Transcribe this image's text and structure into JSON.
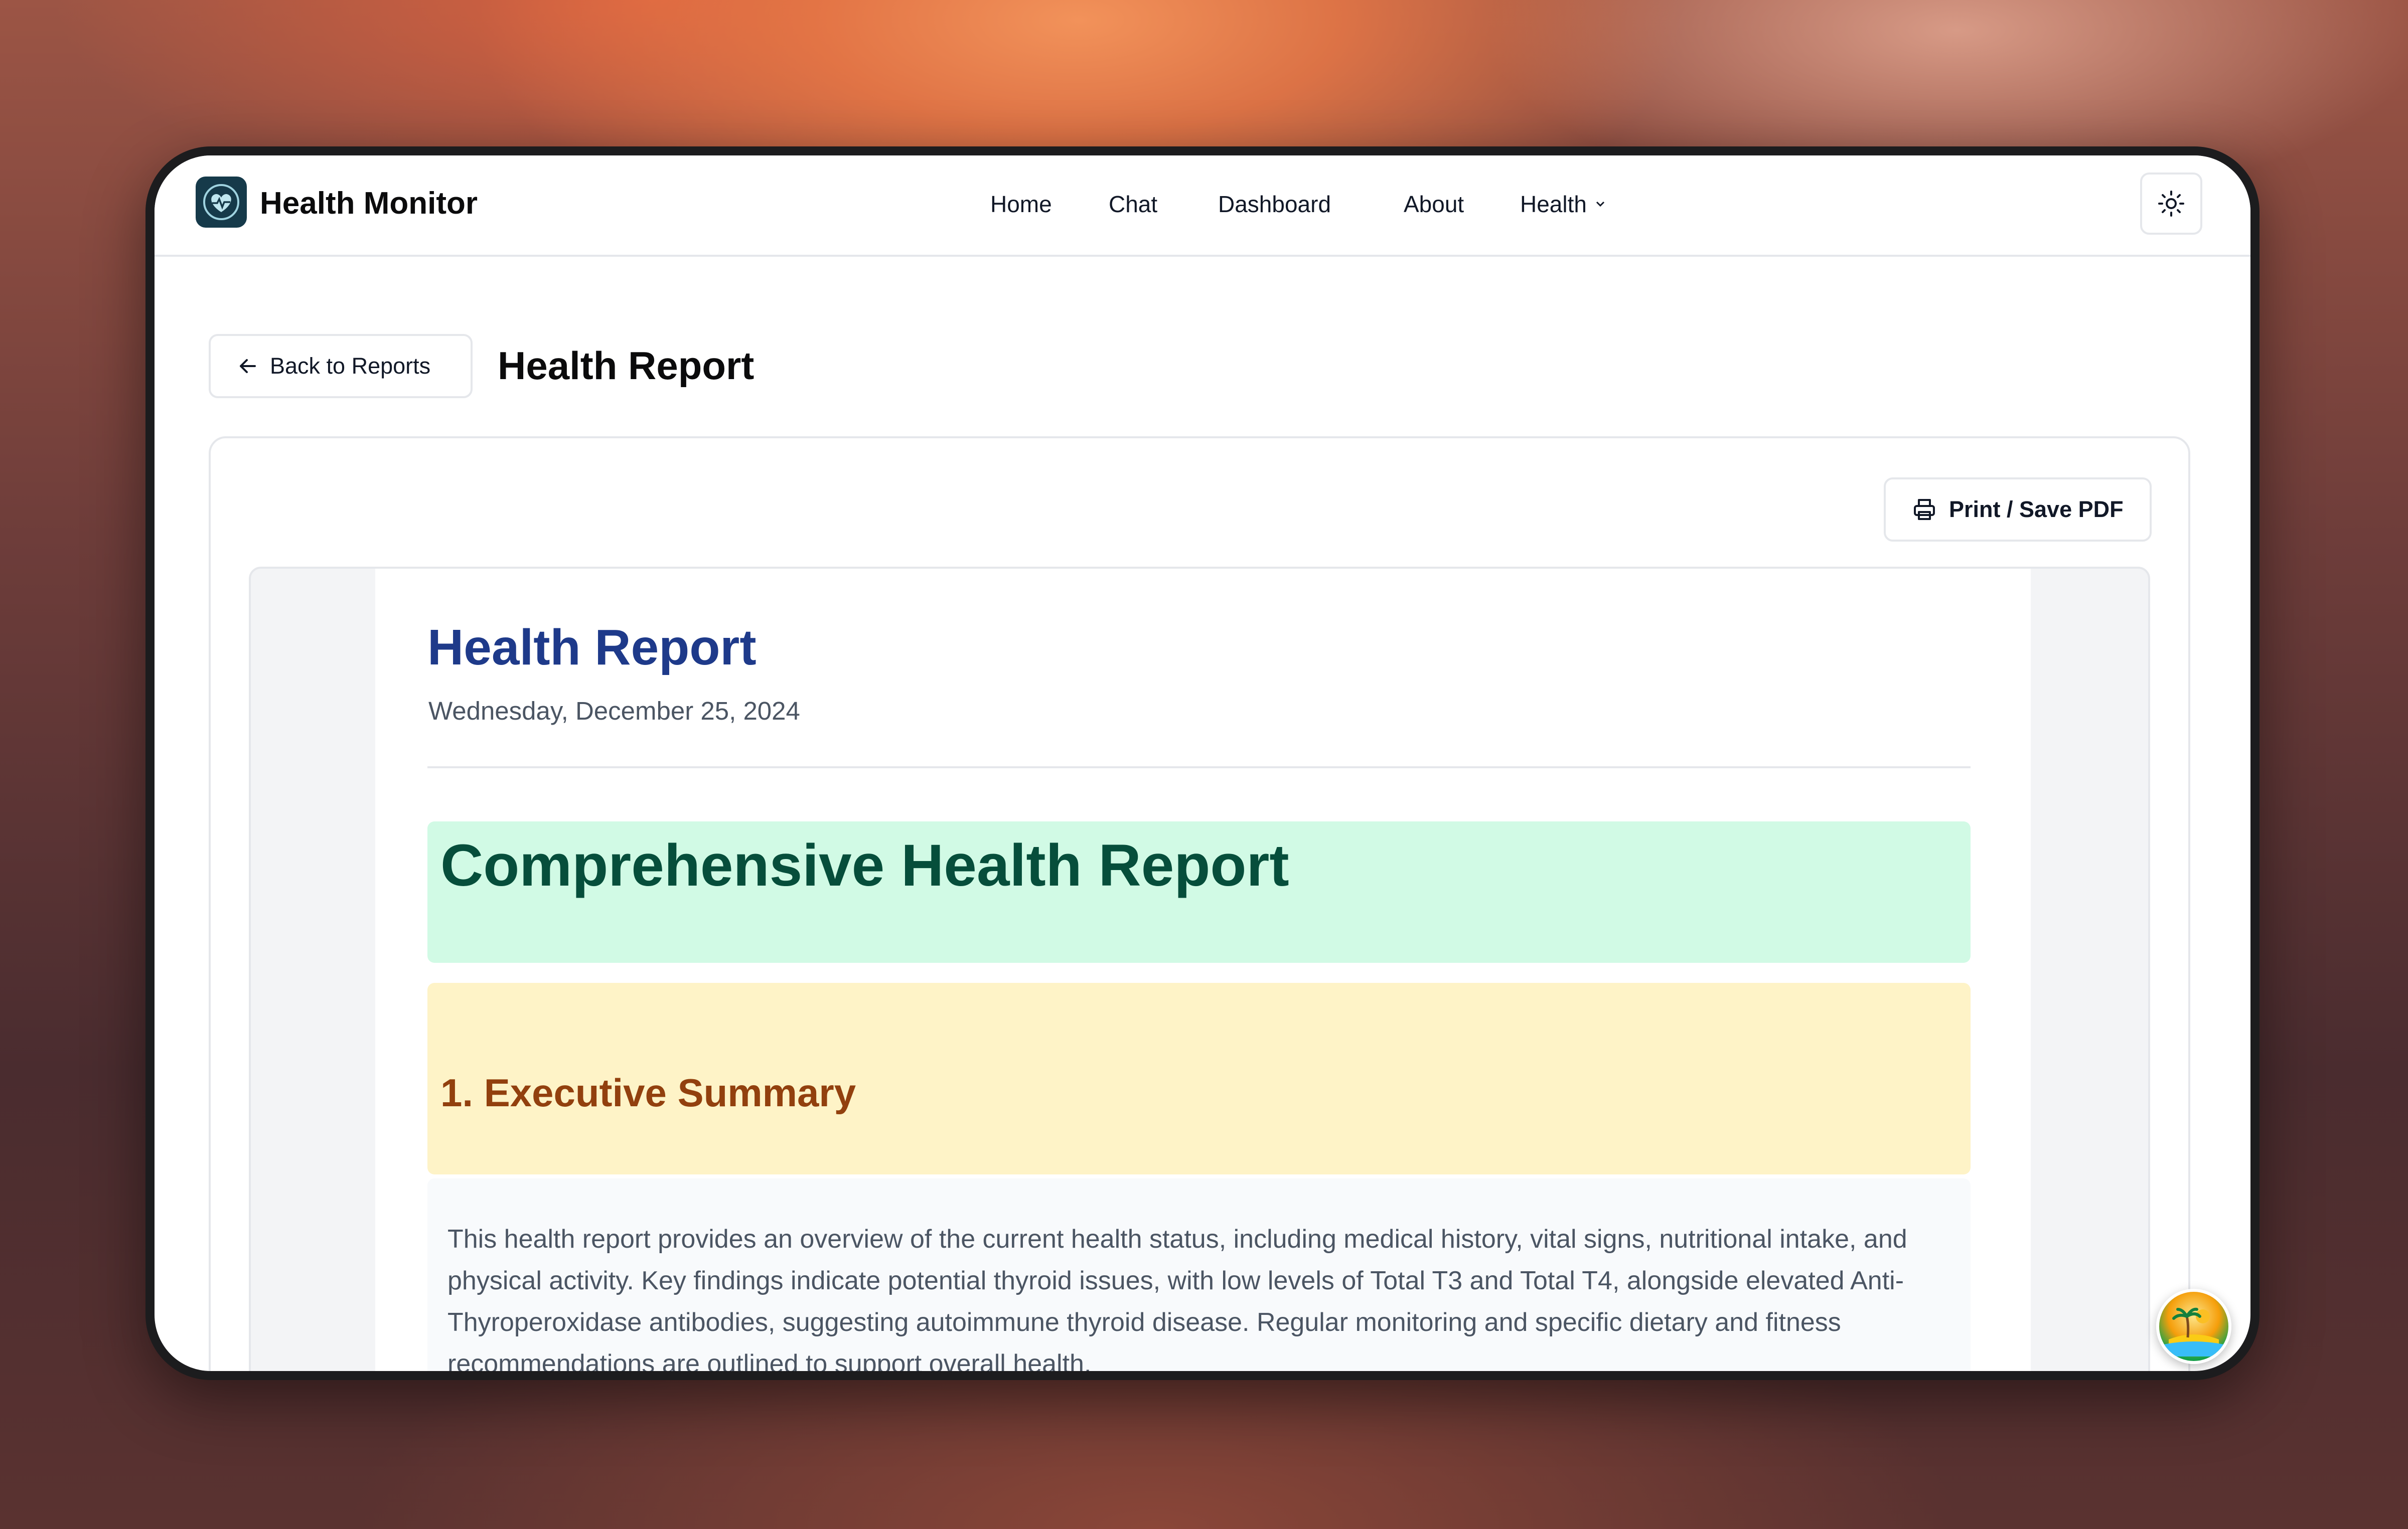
{
  "app": {
    "name": "Health Monitor"
  },
  "nav": {
    "items": [
      {
        "label": "Home"
      },
      {
        "label": "Chat"
      },
      {
        "label": "Dashboard"
      },
      {
        "label": "About"
      },
      {
        "label": "Health"
      }
    ]
  },
  "header": {
    "back_label": "Back to Reports",
    "page_title": "Health Report"
  },
  "toolbar": {
    "print_label": "Print / Save PDF"
  },
  "report": {
    "title": "Health Report",
    "date": "Wednesday, December 25, 2024",
    "main_heading": "Comprehensive Health Report",
    "section_heading": "1. Executive Summary",
    "summary_text": "This health report provides an overview of the current health status, including medical history, vital signs, nutritional intake, and physical activity. Key findings indicate potential thyroid issues, with low levels of Total T3 and Total T4, alongside elevated Anti-Thyroperoxidase antibodies, suggesting autoimmune thyroid disease. Regular monitoring and specific dietary and fitness recommendations are outlined to support overall health."
  },
  "icons": {
    "logo": "heart-shield-logo-icon",
    "theme": "sun-icon",
    "back": "arrow-left-icon",
    "print": "printer-icon",
    "dropdown": "chevron-down-icon",
    "assistant": "island-avatar-icon"
  },
  "colors": {
    "report_title": "#1e3a8a",
    "green_banner_bg": "#d1fae5",
    "green_banner_text": "#064e3b",
    "yellow_banner_bg": "#fef3c7",
    "yellow_banner_text": "#92400e"
  }
}
